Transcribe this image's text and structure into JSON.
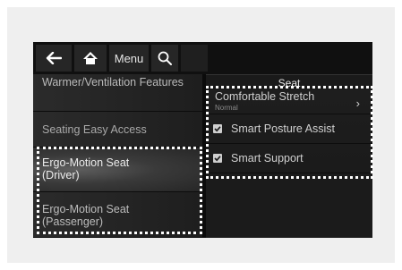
{
  "topbar": {
    "back_icon": "back-arrow-icon",
    "home_icon": "home-icon",
    "menu_label": "Menu",
    "search_icon": "search-icon"
  },
  "screen": {
    "title": "Seat"
  },
  "left_menu": {
    "items": [
      {
        "label": "Warmer/Ventilation Features"
      },
      {
        "label": "Seating Easy Access"
      },
      {
        "label": "Ergo-Motion Seat (Driver)",
        "selected": true
      },
      {
        "label": "Ergo-Motion Seat (Passenger)"
      }
    ]
  },
  "right_options": {
    "comfortable_stretch": {
      "label": "Comfortable Stretch",
      "value": "Normal"
    },
    "smart_posture_assist": {
      "label": "Smart Posture Assist",
      "checked": true
    },
    "smart_support": {
      "label": "Smart Support",
      "checked": true
    }
  }
}
